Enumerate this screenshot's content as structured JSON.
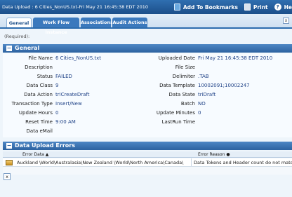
{
  "window": {
    "title": "Data Upload : 6 Cities_NonUS.txt-Fri May 21 16:45:38 EDT 2010",
    "add_bookmarks": "Add To Bookmarks",
    "print": "Print",
    "help": "He"
  },
  "tabs": [
    {
      "label": "General",
      "active": true
    },
    {
      "label": "Work Flow Instance",
      "active": false
    },
    {
      "label": "Associations",
      "active": false
    },
    {
      "label": "Audit Actions",
      "active": false
    }
  ],
  "close_tab": "x",
  "required_label": "(Required):",
  "general": {
    "header": "General",
    "left_fields": [
      {
        "label": "File Name",
        "value": "6 Cities_NonUS.txt"
      },
      {
        "label": "Description",
        "value": ""
      },
      {
        "label": "Status",
        "value": "FAILED"
      },
      {
        "label": "Data Class",
        "value": "9"
      },
      {
        "label": "Data Action",
        "value": "triCreateDraft"
      },
      {
        "label": "Transaction Type",
        "value": "Insert/New"
      },
      {
        "label": "Update Hours",
        "value": "0"
      },
      {
        "label": "Reset Time",
        "value": "9:00 AM"
      },
      {
        "label": "Data eMail",
        "value": ""
      }
    ],
    "right_fields": [
      {
        "label": "Uploaded Date",
        "value": "Fri May 21 16:45:38 EDT 2010"
      },
      {
        "label": "File Size",
        "value": ""
      },
      {
        "label": "Delimiter",
        "value": ".TAB"
      },
      {
        "label": "Data Template",
        "value": "10002091;10002247"
      },
      {
        "label": "Data State",
        "value": "triDraft"
      },
      {
        "label": "Batch",
        "value": "NO"
      },
      {
        "label": "Update Minutes",
        "value": "0"
      },
      {
        "label": "LastRun Time",
        "value": ""
      }
    ]
  },
  "errors": {
    "header": "Data Upload Errors",
    "columns": [
      {
        "label": "Error Data",
        "sort": "▲"
      },
      {
        "label": "Error Reason",
        "sort": "●"
      }
    ],
    "rows": [
      {
        "error_data": "Auckland  \\World\\Australasia\\New Zealand \\World\\North America\\Canada\\",
        "error_reason": "Data Tokens and Header count do not match"
      }
    ],
    "remove_button": "x"
  },
  "colors": {
    "title_bar": "#1c4f8a",
    "tab_active_text": "#1c4f8a",
    "section_header": "#2d62a0",
    "background": "#eef5fb"
  }
}
